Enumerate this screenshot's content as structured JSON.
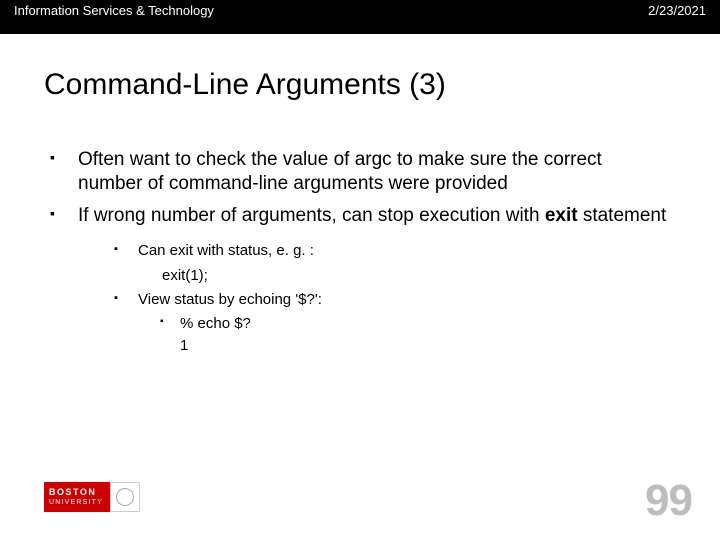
{
  "header": {
    "left": "Information Services & Technology",
    "right": "2/23/2021"
  },
  "title": "Command-Line Arguments (3)",
  "bullets": {
    "b1": "Often want to check the value of argc to make sure the correct number of command-line arguments were provided",
    "b2_pre": "If wrong number of arguments, can stop execution with ",
    "b2_bold": "exit",
    "b2_post": " statement",
    "s1": "Can exit with status, e. g. :",
    "s1a": "exit(1);",
    "s2": "View status by echoing '$?':",
    "s2a": "% echo $?",
    "s2b": "1"
  },
  "logo": {
    "line1": "BOSTON",
    "line2": "UNIVERSITY"
  },
  "page": "99"
}
